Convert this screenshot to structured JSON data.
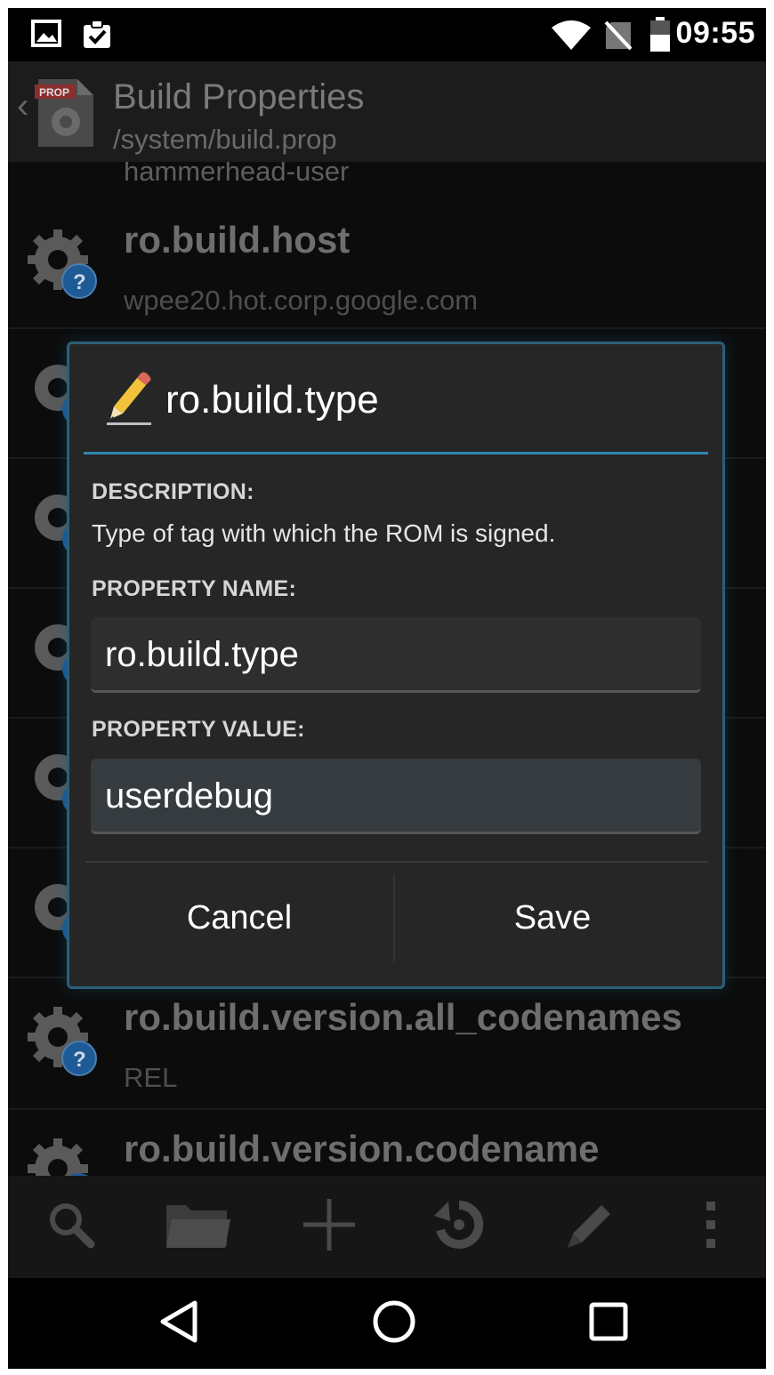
{
  "status_bar": {
    "time": "09:55"
  },
  "action_bar": {
    "title": "Build Properties",
    "subtitle": "/system/build.prop",
    "app_icon_text": "PROP"
  },
  "list": {
    "clipped_value": "hammerhead-user",
    "items": [
      {
        "name": "ro.build.host",
        "value": "wpee20.hot.corp.google.com"
      },
      {
        "name": "ro.build.version.all_codenames",
        "value": "REL"
      },
      {
        "name": "ro.build.version.codename",
        "value": ""
      }
    ]
  },
  "dialog": {
    "title": "ro.build.type",
    "description_label": "DESCRIPTION:",
    "description": "Type of tag with which the ROM is signed.",
    "property_name_label": "PROPERTY NAME:",
    "property_name_value": "ro.build.type",
    "property_value_label": "PROPERTY VALUE:",
    "property_value_value": "userdebug",
    "cancel_label": "Cancel",
    "save_label": "Save"
  },
  "toolbar": {
    "icons": [
      "search-icon",
      "folder-icon",
      "add-icon",
      "restore-icon",
      "edit-icon",
      "overflow-menu-icon"
    ]
  },
  "navigation": {
    "icons": [
      "back-icon",
      "home-icon",
      "recents-icon"
    ]
  },
  "colors": {
    "accent": "#2f86b0",
    "dialog_bg": "#262626",
    "list_bg": "#0c0c0c",
    "help_badge": "#1e5a96"
  }
}
